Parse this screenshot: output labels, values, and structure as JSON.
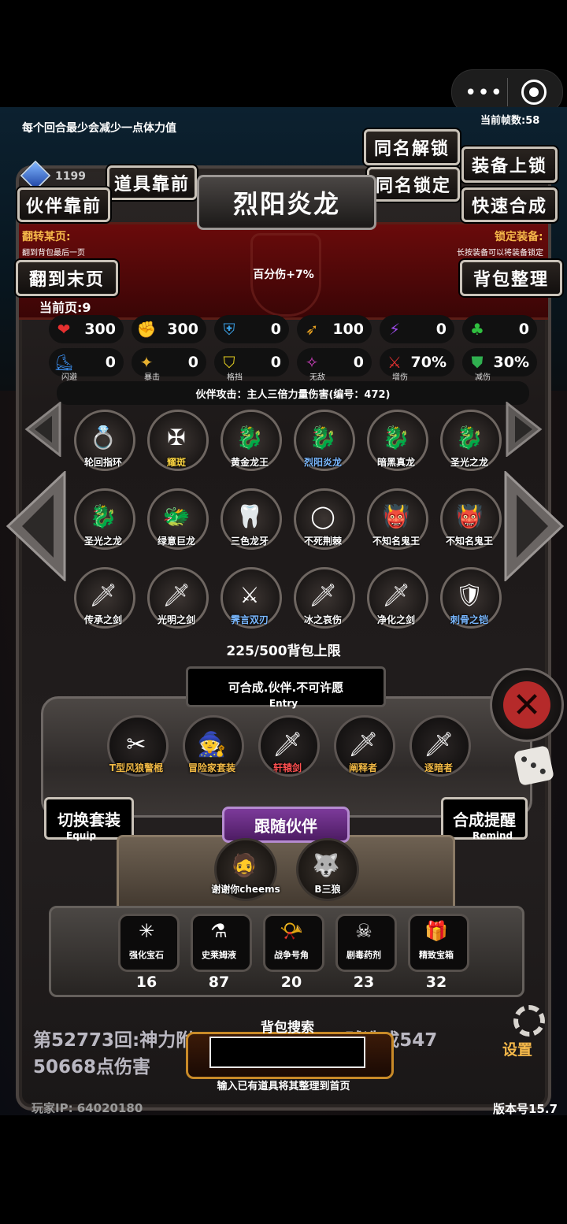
{
  "hud": {
    "stamina_hint": "每个回合最少会减少一点体力值",
    "fps": "当前帧数:58",
    "gems": "1199",
    "version": "版本号15.7",
    "player_ip": "玩家IP:  64020180"
  },
  "buttons": {
    "partner_front": "伙伴靠前",
    "item_front": "道具靠前",
    "same_unlock": "同名解锁",
    "same_lock": "同名锁定",
    "equip_lock": "装备上锁",
    "quick_merge": "快速合成",
    "last_page": "翻到末页",
    "bag_sort": "背包整理",
    "switch_set": "切换套装",
    "switch_set_sub": "Equip",
    "merge_remind": "合成提醒",
    "merge_remind_sub": "Remind",
    "follow_partner": "跟随伙伴",
    "settings": "设置"
  },
  "selected": {
    "name": "烈阳炎龙",
    "effect": "百分伤+7%"
  },
  "tips": {
    "flip_title": "翻转某页:",
    "flip_desc": "翻到背包最后一页",
    "lock_title": "锁定装备:",
    "lock_desc": "长按装备可以将装备锁定"
  },
  "page": "当前页:9",
  "stats": [
    {
      "icon": "heart-icon",
      "glyph": "❤",
      "color": "#e63030",
      "value": "300",
      "label": ""
    },
    {
      "icon": "strength-icon",
      "glyph": "✊",
      "color": "#e6c020",
      "value": "300",
      "label": ""
    },
    {
      "icon": "armor-icon",
      "glyph": "⛨",
      "color": "#3aa0e6",
      "value": "0",
      "label": ""
    },
    {
      "icon": "bow-icon",
      "glyph": "➶",
      "color": "#e6a020",
      "value": "100",
      "label": ""
    },
    {
      "icon": "lightning-icon",
      "glyph": "⚡",
      "color": "#9a4ae6",
      "value": "0",
      "label": ""
    },
    {
      "icon": "clover-icon",
      "glyph": "♣",
      "color": "#30c040",
      "value": "0",
      "label": ""
    },
    {
      "icon": "boot-icon",
      "glyph": "⛸",
      "color": "#3a8ae6",
      "value": "0",
      "label": "闪避"
    },
    {
      "icon": "crit-icon",
      "glyph": "✦",
      "color": "#e6b030",
      "value": "0",
      "label": "暴击"
    },
    {
      "icon": "block-icon",
      "glyph": "⛉",
      "color": "#e6d020",
      "value": "0",
      "label": "格挡"
    },
    {
      "icon": "invincible-icon",
      "glyph": "✧",
      "color": "#d040c0",
      "value": "0",
      "label": "无敌"
    },
    {
      "icon": "crossed-swords-icon",
      "glyph": "⚔",
      "color": "#e03030",
      "value": "70%",
      "label": "增伤"
    },
    {
      "icon": "shield-icon",
      "glyph": "⛊",
      "color": "#30b050",
      "value": "30%",
      "label": "减伤"
    }
  ],
  "partner_attack": "伙伴攻击：主人三倍力量伤害(编号：472)",
  "items": [
    {
      "name": "轮回指环",
      "icon": "ring-icon",
      "glyph": "💍",
      "color": "#ffffff"
    },
    {
      "name": "耀斑",
      "icon": "crossbow-icon",
      "glyph": "✠",
      "color": "#f6d040"
    },
    {
      "name": "黄金龙王",
      "icon": "gold-dragon-icon",
      "glyph": "🐉",
      "color": "#ffffff"
    },
    {
      "name": "烈阳炎龙",
      "icon": "fire-dragon-icon",
      "glyph": "🐉",
      "color": "#7ab8ff"
    },
    {
      "name": "暗黑真龙",
      "icon": "dark-dragon-icon",
      "glyph": "🐉",
      "color": "#ffffff"
    },
    {
      "name": "圣光之龙",
      "icon": "holy-dragon-icon",
      "glyph": "🐉",
      "color": "#ffffff"
    },
    {
      "name": "圣光之龙",
      "icon": "holy-dragon-icon",
      "glyph": "🐉",
      "color": "#ffffff"
    },
    {
      "name": "绿意巨龙",
      "icon": "green-dragon-icon",
      "glyph": "🐲",
      "color": "#ffffff"
    },
    {
      "name": "三色龙牙",
      "icon": "dragon-fang-icon",
      "glyph": "🦷",
      "color": "#ffffff"
    },
    {
      "name": "不死荆棘",
      "icon": "thorn-ring-icon",
      "glyph": "◯",
      "color": "#ffffff"
    },
    {
      "name": "不知名鬼王",
      "icon": "ghost-king-icon",
      "glyph": "👹",
      "color": "#ffffff"
    },
    {
      "name": "不知名鬼王",
      "icon": "ghost-king-icon",
      "glyph": "👹",
      "color": "#ffffff"
    },
    {
      "name": "传承之剑",
      "icon": "sword-icon",
      "glyph": "🗡",
      "color": "#ffffff"
    },
    {
      "name": "光明之剑",
      "icon": "sword-icon",
      "glyph": "🗡",
      "color": "#ffffff"
    },
    {
      "name": "霁言双刃",
      "icon": "twin-blade-icon",
      "glyph": "⚔",
      "color": "#7ab8ff"
    },
    {
      "name": "冰之哀伤",
      "icon": "ice-sword-icon",
      "glyph": "🗡",
      "color": "#ffffff"
    },
    {
      "name": "净化之剑",
      "icon": "greatsword-icon",
      "glyph": "🗡",
      "color": "#ffffff"
    },
    {
      "name": "刺骨之铠",
      "icon": "armor-icon",
      "glyph": "🛡",
      "color": "#7ab8ff"
    }
  ],
  "bag_capacity": "225/500背包上限",
  "entry": {
    "text": "可合成.伙伴.不可许愿",
    "label": "Entry"
  },
  "equipment": [
    {
      "name": "T型风狼警棍",
      "icon": "baton-icon",
      "glyph": "✂",
      "color": "#f0b844"
    },
    {
      "name": "冒险家套装",
      "icon": "adventurer-icon",
      "glyph": "🧙",
      "color": "#f0b844"
    },
    {
      "name": "轩辕剑",
      "icon": "sword-icon",
      "glyph": "🗡",
      "color": "#ff5050"
    },
    {
      "name": "阐释者",
      "icon": "sword-icon",
      "glyph": "🗡",
      "color": "#f0b844"
    },
    {
      "name": "逐暗者",
      "icon": "sword-icon",
      "glyph": "🗡",
      "color": "#f0b844"
    }
  ],
  "followers": [
    {
      "name": "谢谢你cheems",
      "icon": "warrior-portrait-icon",
      "glyph": "🧔"
    },
    {
      "name": "B三狼",
      "icon": "wolf-pack-icon",
      "glyph": "🐺"
    }
  ],
  "inventory": [
    {
      "name": "强化宝石",
      "icon": "green-gem-icon",
      "glyph": "✳",
      "count": "16"
    },
    {
      "name": "史莱姆液",
      "icon": "potion-icon",
      "glyph": "⚗",
      "count": "87"
    },
    {
      "name": "战争号角",
      "icon": "horn-icon",
      "glyph": "📯",
      "count": "20"
    },
    {
      "name": "剧毒药剂",
      "icon": "poison-icon",
      "glyph": "☠",
      "count": "23"
    },
    {
      "name": "精致宝箱",
      "icon": "chest-icon",
      "glyph": "🎁",
      "count": "32"
    }
  ],
  "battle_log": {
    "line1": "第52773回:神力附",
    "line1_tail": "贼造成547",
    "line2": "50668点伤害"
  },
  "search": {
    "label": "背包搜索",
    "value": "",
    "tip": "输入已有道具将其整理到首页"
  }
}
